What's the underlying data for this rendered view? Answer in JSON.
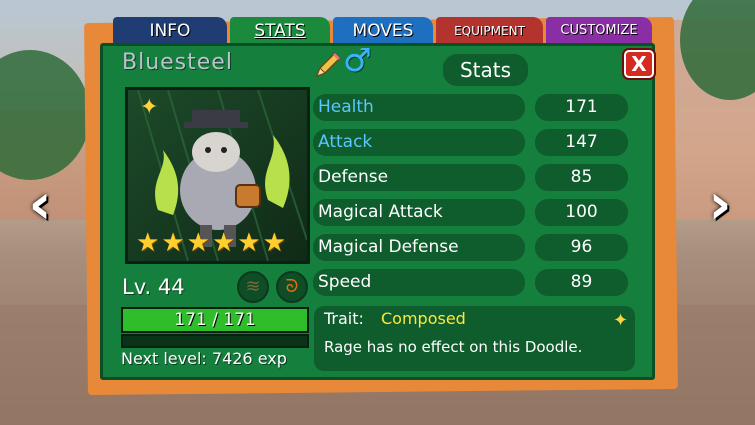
{
  "tabs": {
    "info": "INFO",
    "stats": "STATS",
    "moves": "MOVES",
    "equipment": "EQUIPMENT",
    "customize": "CUSTOMIZE"
  },
  "doodle": {
    "name": "Bluesteel",
    "gender_symbol": "♂",
    "stars": 6,
    "level": "Lv. 44",
    "hp_text": "171 / 171",
    "hp_fraction": 1.0,
    "next_level": "Next level: 7426 exp",
    "types": [
      "claw-type-icon",
      "fire-type-icon"
    ]
  },
  "panel": {
    "title": "Stats",
    "close_label": "X"
  },
  "stats": [
    {
      "label": "Health",
      "value": "171",
      "highlight": true
    },
    {
      "label": "Attack",
      "value": "147",
      "highlight": true
    },
    {
      "label": "Defense",
      "value": "85",
      "highlight": false
    },
    {
      "label": "Magical Attack",
      "value": "100",
      "highlight": false
    },
    {
      "label": "Magical Defense",
      "value": "96",
      "highlight": false
    },
    {
      "label": "Speed",
      "value": "89",
      "highlight": false
    }
  ],
  "trait": {
    "label": "Trait:",
    "name": "Composed",
    "description": "Rage has no effect on this Doodle."
  },
  "nav": {
    "prev": "‹",
    "next": "›"
  },
  "colors": {
    "panel_green": "#157f3e",
    "row_green": "#0f5c2c",
    "highlight_blue": "#5cc6ff",
    "trait_yellow": "#ffe83a",
    "star_gold": "#ffcf2e"
  }
}
